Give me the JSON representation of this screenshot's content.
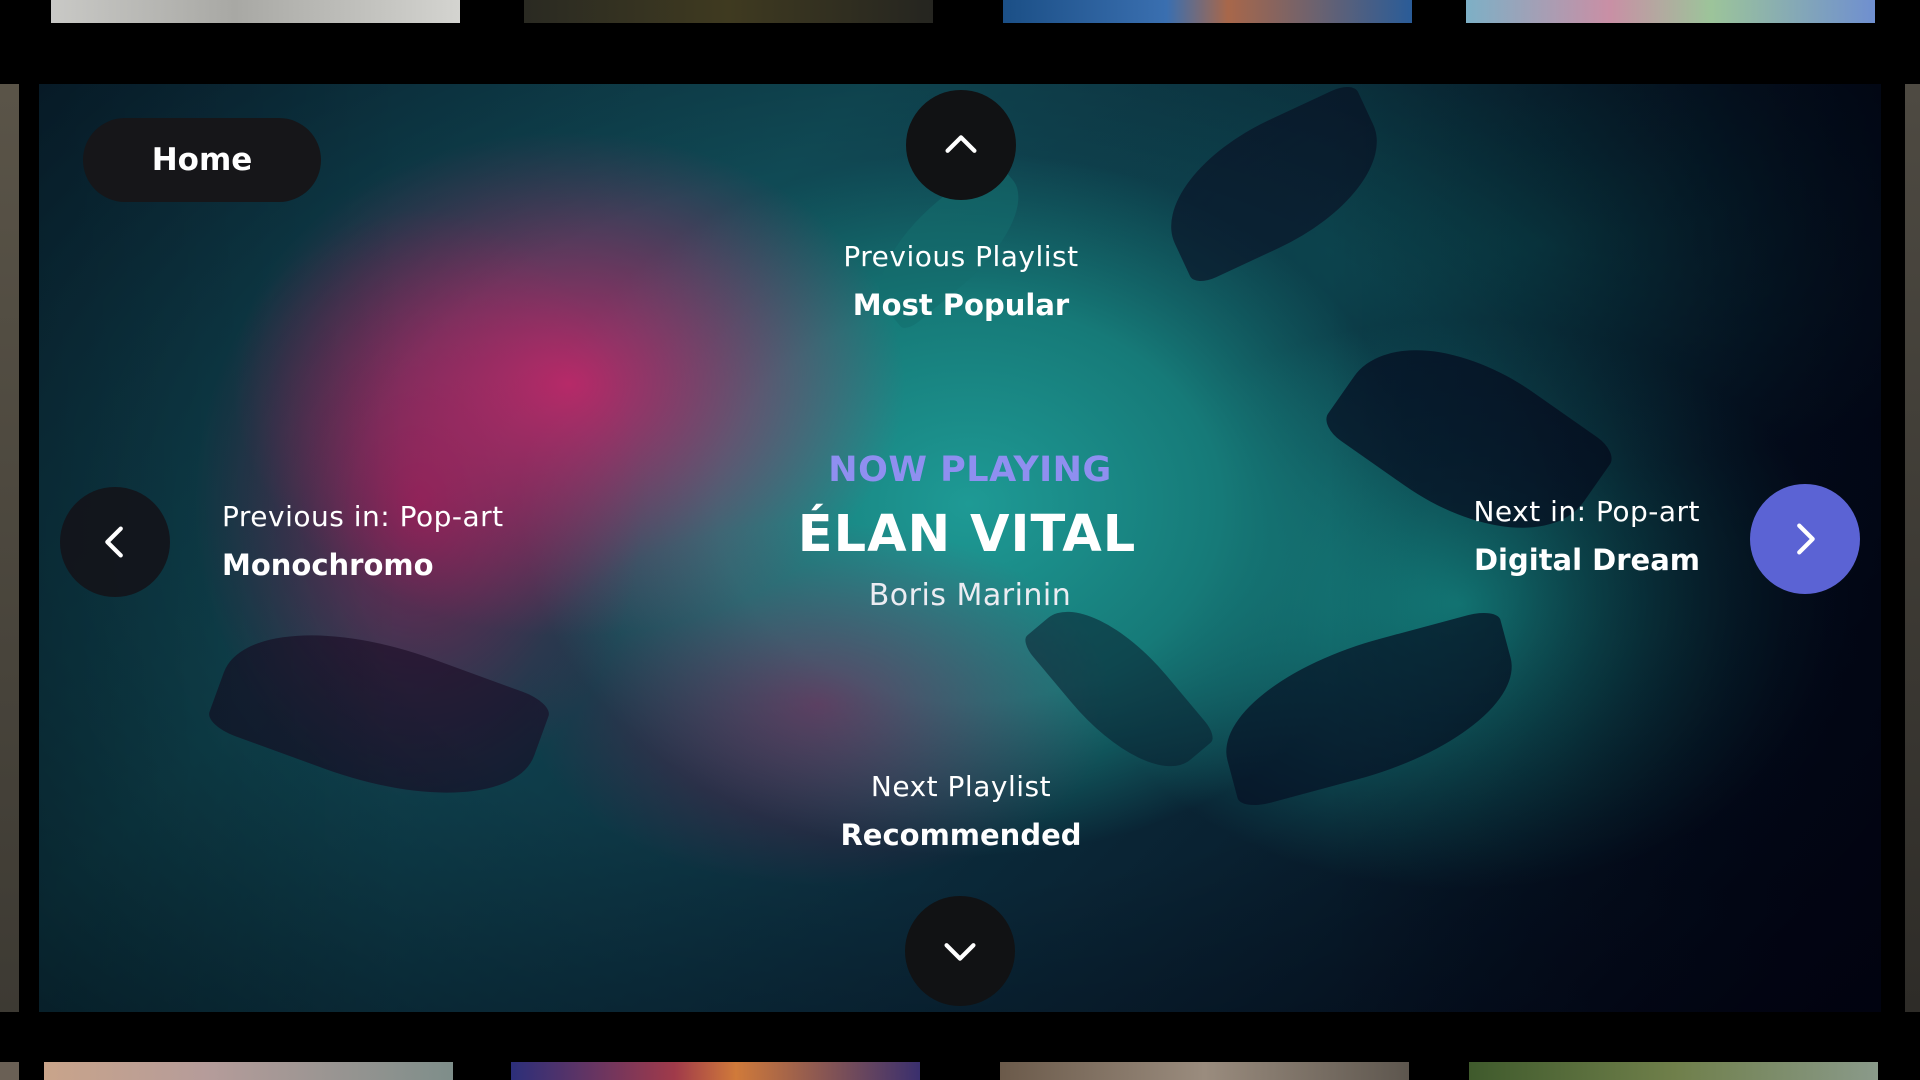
{
  "nav": {
    "home_label": "Home"
  },
  "now_playing": {
    "label": "NOW PLAYING",
    "title": "ÉLAN VITAL",
    "artist": "Boris Marinin"
  },
  "previous_playlist": {
    "label": "Previous Playlist",
    "name": "Most Popular"
  },
  "next_playlist": {
    "label": "Next Playlist",
    "name": "Recommended"
  },
  "previous_track": {
    "label": "Previous in: Pop-art",
    "name": "Monochromo"
  },
  "next_track": {
    "label": "Next in: Pop-art",
    "name": "Digital Dream"
  },
  "icons": {
    "up": "chevron-up-icon",
    "down": "chevron-down-icon",
    "left": "chevron-left-icon",
    "right": "chevron-right-icon"
  },
  "colors": {
    "accent": "#5b63d4",
    "now_playing_label": "#8f8ff0",
    "button_dark": "#161619",
    "background": "#000000"
  }
}
